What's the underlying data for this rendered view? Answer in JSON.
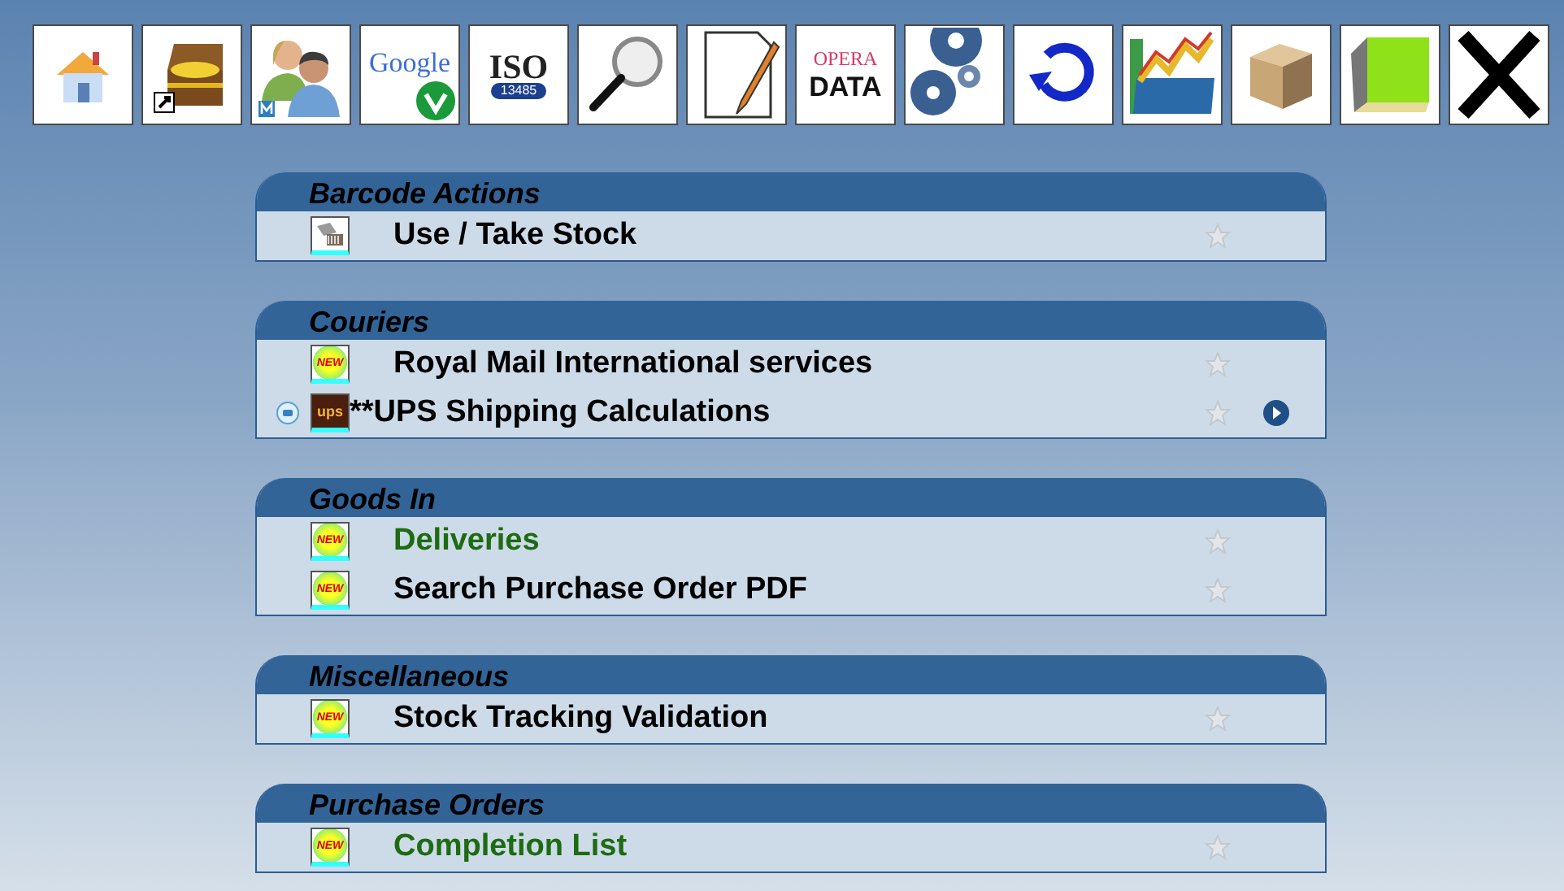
{
  "toolbar": [
    {
      "kind": "home"
    },
    {
      "kind": "chest"
    },
    {
      "kind": "users"
    },
    {
      "kind": "google",
      "text": [
        "Google"
      ]
    },
    {
      "kind": "iso",
      "text": [
        "ISO",
        "13485"
      ]
    },
    {
      "kind": "magnifier"
    },
    {
      "kind": "edit"
    },
    {
      "kind": "opera",
      "text": [
        "OPERA",
        "DATA"
      ]
    },
    {
      "kind": "gears"
    },
    {
      "kind": "refresh"
    },
    {
      "kind": "chart"
    },
    {
      "kind": "box"
    },
    {
      "kind": "book"
    },
    {
      "kind": "close"
    }
  ],
  "sections": [
    {
      "title": "Barcode Actions",
      "items": [
        {
          "label": "Use / Take Stock",
          "kind": "barcode",
          "favorite": false,
          "color": "#000000"
        }
      ]
    },
    {
      "title": "Couriers",
      "items": [
        {
          "label": "Royal Mail International services",
          "kind": "new",
          "badge": "NEW",
          "favorite": false,
          "color": "#000000"
        },
        {
          "label": "**UPS Shipping Calculations",
          "kind": "ups",
          "badge": "ups",
          "info": true,
          "favorite": false,
          "action": true,
          "color": "#000000"
        }
      ]
    },
    {
      "title": "Goods In",
      "items": [
        {
          "label": "Deliveries",
          "kind": "new",
          "badge": "NEW",
          "favorite": false,
          "color": "#1d6b12"
        },
        {
          "label": "Search Purchase Order PDF",
          "kind": "new",
          "badge": "NEW",
          "favorite": false,
          "color": "#000000"
        }
      ]
    },
    {
      "title": "Miscellaneous",
      "items": [
        {
          "label": "Stock Tracking Validation",
          "kind": "new",
          "badge": "NEW",
          "favorite": false,
          "color": "#000000"
        }
      ]
    },
    {
      "title": "Purchase Orders",
      "items": [
        {
          "label": "Completion List",
          "kind": "new",
          "badge": "NEW",
          "favorite": false,
          "color": "#1d6b12"
        }
      ]
    }
  ]
}
